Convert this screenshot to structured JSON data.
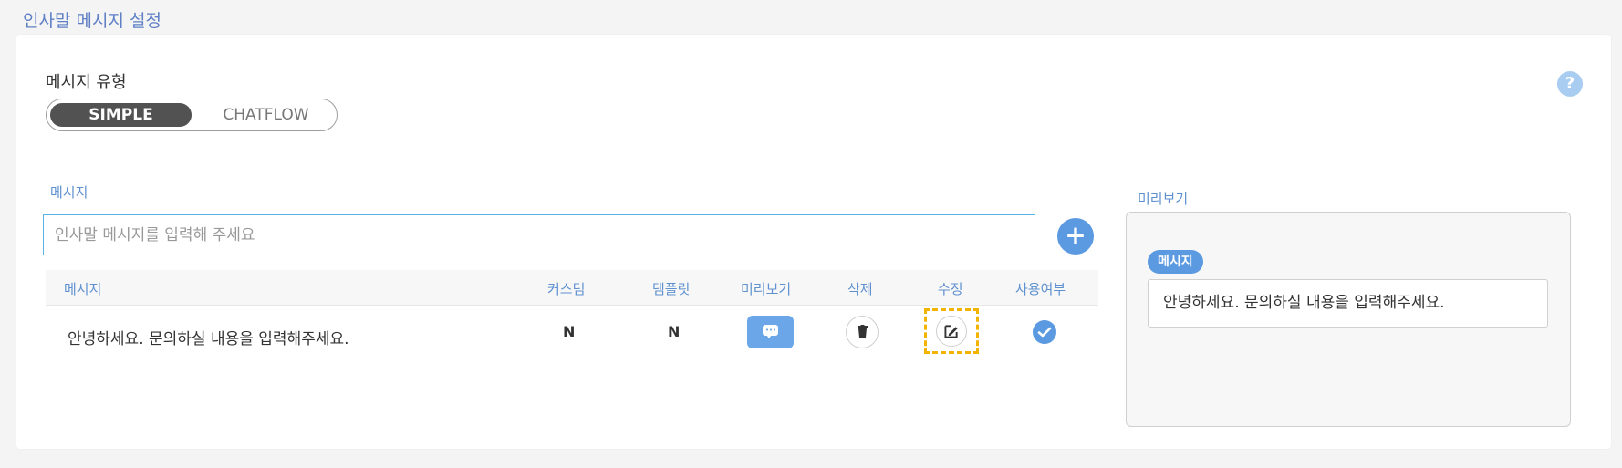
{
  "page": {
    "title": "인사말 메시지 설정"
  },
  "message_type": {
    "label": "메시지 유형",
    "options": [
      "SIMPLE",
      "CHATFLOW"
    ],
    "selected": "SIMPLE"
  },
  "message_input": {
    "label": "메시지",
    "placeholder": "인사말 메시지를 입력해 주세요",
    "value": ""
  },
  "table": {
    "headers": [
      "메시지",
      "커스텀",
      "템플릿",
      "미리보기",
      "삭제",
      "수정",
      "사용여부"
    ],
    "rows": [
      {
        "message": "안녕하세요. 문의하실 내용을 입력해주세요.",
        "custom": "N",
        "template": "N",
        "enabled": true
      }
    ]
  },
  "preview": {
    "label": "미리보기",
    "badge": "메시지",
    "text": "안녕하세요. 문의하실 내용을 입력해주세요."
  },
  "icons": {
    "help": "help-circle-icon",
    "add": "plus-circle-icon",
    "preview": "chat-bubble-icon",
    "delete": "trash-icon",
    "edit": "edit-icon",
    "enabled": "check-circle-icon"
  },
  "colors": {
    "accent": "#5b9ae0",
    "title": "#5f7fc6",
    "highlight": "#f2b400"
  }
}
